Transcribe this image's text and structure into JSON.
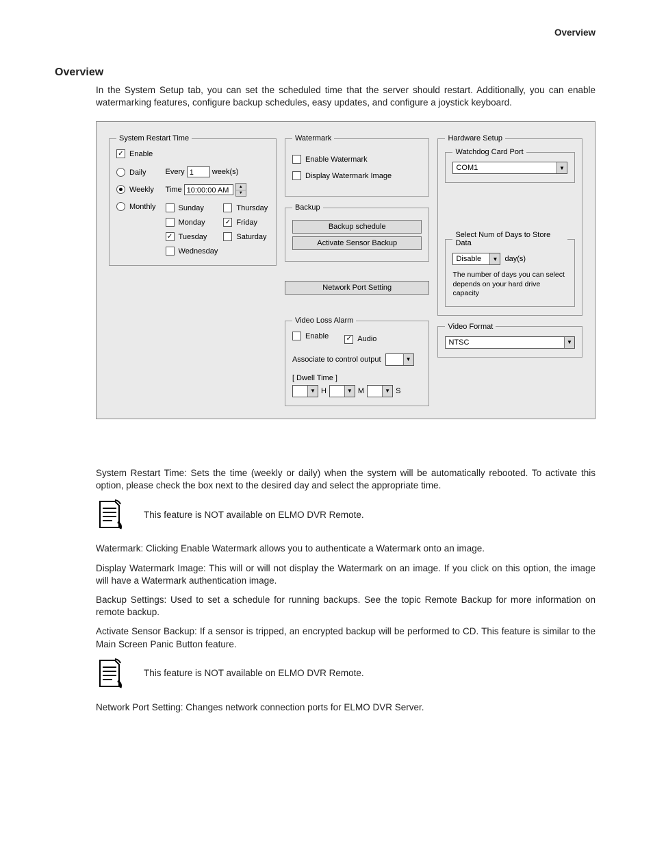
{
  "page_header": "Overview",
  "section_title": "Overview",
  "intro_paragraph": "In the System Setup tab, you can set the scheduled time that the server should restart. Additionally, you can enable watermarking features, configure backup schedules, easy updates, and configure a joystick keyboard.",
  "restart": {
    "legend": "System Restart Time",
    "enable_label": "Enable",
    "enable_checked": true,
    "radios": {
      "daily": "Daily",
      "weekly": "Weekly",
      "monthly": "Monthly",
      "selected": "Weekly"
    },
    "every_label": "Every",
    "every_value": "1",
    "every_unit": "week(s)",
    "time_label": "Time",
    "time_value": "10:00:00 AM",
    "days": [
      {
        "label": "Sunday",
        "checked": false
      },
      {
        "label": "Monday",
        "checked": false
      },
      {
        "label": "Tuesday",
        "checked": true
      },
      {
        "label": "Wednesday",
        "checked": false
      },
      {
        "label": "Thursday",
        "checked": false
      },
      {
        "label": "Friday",
        "checked": true
      },
      {
        "label": "Saturday",
        "checked": false
      }
    ]
  },
  "watermark": {
    "legend": "Watermark",
    "enable_label": "Enable Watermark",
    "enable_checked": false,
    "display_label": "Display Watermark Image",
    "display_checked": false
  },
  "backup": {
    "legend": "Backup",
    "schedule_btn": "Backup schedule",
    "activate_btn": "Activate Sensor Backup"
  },
  "network_btn": "Network Port Setting",
  "videoloss": {
    "legend": "Video Loss Alarm",
    "enable_label": "Enable",
    "enable_checked": false,
    "audio_label": "Audio",
    "audio_checked": true,
    "associate_label": "Associate to control output",
    "associate_value": "",
    "dwell_label": "[ Dwell Time ]",
    "h_label": "H",
    "m_label": "M",
    "s_label": "S"
  },
  "hardware": {
    "legend": "Hardware Setup",
    "watchdog_legend": "Watchdog Card Port",
    "watchdog_value": "COM1",
    "store_legend": "Select Num of Days to Store Data",
    "store_value": "Disable",
    "store_unit": "day(s)",
    "store_note": "The number of days you can select depends on your hard drive capacity"
  },
  "videoformat": {
    "legend": "Video Format",
    "value": "NTSC"
  },
  "body": {
    "p1": "System Restart Time: Sets the time (weekly or daily) when the system will be automatically rebooted. To activate this option, please check the box next to the desired day and select the appropriate time.",
    "note1": "This feature is NOT available on ELMO DVR Remote.",
    "p2": "Watermark: Clicking Enable Watermark allows you to authenticate a Watermark onto an image.",
    "p3": "Display Watermark Image: This will or will not display the Watermark on an image. If you click on this option, the image will have a Watermark authentication image.",
    "p4": "Backup Settings: Used to set a schedule for running backups. See the topic Remote Backup for more information on remote backup.",
    "p5": "Activate Sensor Backup: If a sensor is tripped, an encrypted backup will be performed to CD. This feature is similar to the Main Screen Panic Button feature.",
    "note2": "This feature is NOT available on ELMO DVR Remote.",
    "p6": "Network Port Setting: Changes network connection ports for ELMO DVR Server."
  }
}
